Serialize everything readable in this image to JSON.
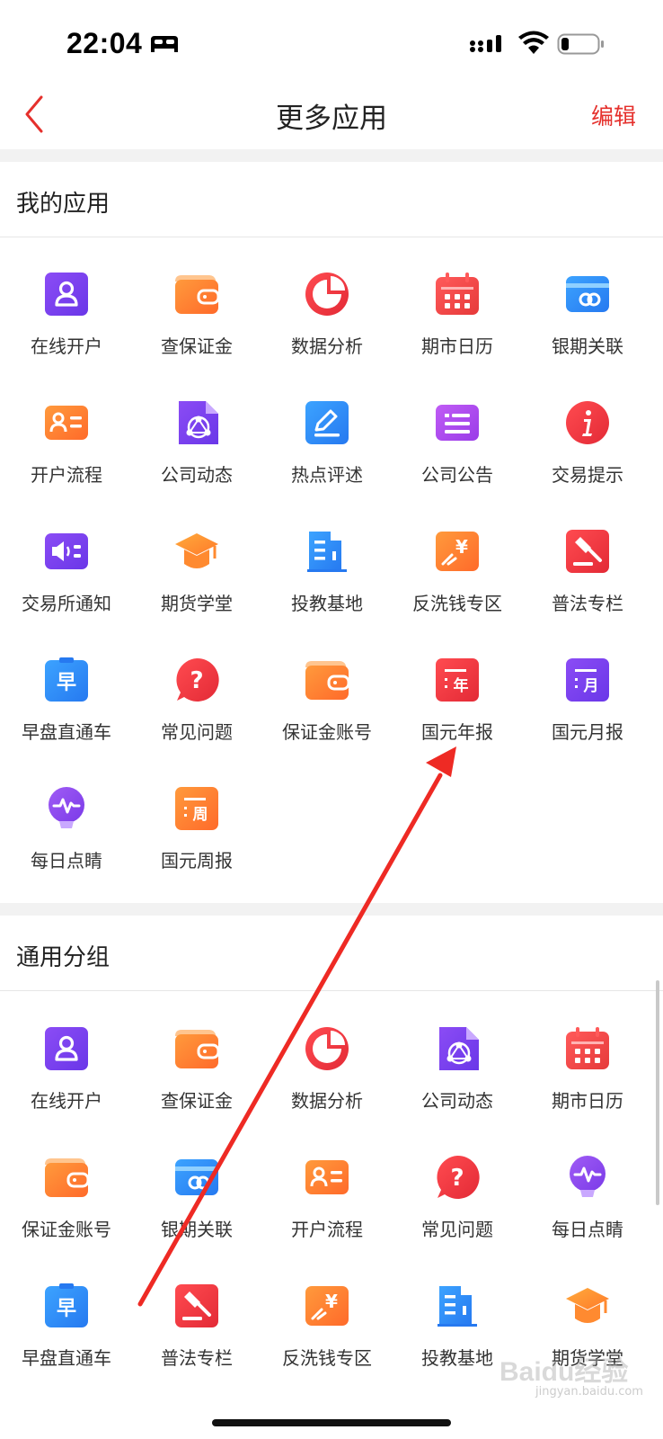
{
  "status_bar": {
    "time": "22:04"
  },
  "nav": {
    "title": "更多应用",
    "edit_label": "编辑"
  },
  "sections": [
    {
      "title": "我的应用",
      "items": [
        {
          "label": "在线开户",
          "icon": "user-card-icon"
        },
        {
          "label": "查保证金",
          "icon": "wallet-icon"
        },
        {
          "label": "数据分析",
          "icon": "pie-chart-icon"
        },
        {
          "label": "期市日历",
          "icon": "calendar-icon"
        },
        {
          "label": "银期关联",
          "icon": "bank-link-icon"
        },
        {
          "label": "开户流程",
          "icon": "id-card-icon"
        },
        {
          "label": "公司动态",
          "icon": "share-doc-icon"
        },
        {
          "label": "热点评述",
          "icon": "edit-icon"
        },
        {
          "label": "公司公告",
          "icon": "notice-icon"
        },
        {
          "label": "交易提示",
          "icon": "info-icon"
        },
        {
          "label": "交易所通知",
          "icon": "speaker-icon"
        },
        {
          "label": "期货学堂",
          "icon": "graduation-cap-icon"
        },
        {
          "label": "投教基地",
          "icon": "building-icon"
        },
        {
          "label": "反洗钱专区",
          "icon": "anti-money-laundering-icon"
        },
        {
          "label": "普法专栏",
          "icon": "gavel-icon"
        },
        {
          "label": "早盘直通车",
          "icon": "morning-report-icon",
          "glyph": "早"
        },
        {
          "label": "常见问题",
          "icon": "question-icon"
        },
        {
          "label": "保证金账号",
          "icon": "wallet-icon"
        },
        {
          "label": "国元年报",
          "icon": "annual-report-icon",
          "glyph": "年"
        },
        {
          "label": "国元月报",
          "icon": "monthly-report-icon",
          "glyph": "月"
        },
        {
          "label": "每日点睛",
          "icon": "pulse-bulb-icon"
        },
        {
          "label": "国元周报",
          "icon": "weekly-report-icon",
          "glyph": "周"
        }
      ]
    },
    {
      "title": "通用分组",
      "items": [
        {
          "label": "在线开户",
          "icon": "user-card-icon"
        },
        {
          "label": "查保证金",
          "icon": "wallet-icon"
        },
        {
          "label": "数据分析",
          "icon": "pie-chart-icon"
        },
        {
          "label": "公司动态",
          "icon": "share-doc-icon"
        },
        {
          "label": "期市日历",
          "icon": "calendar-icon"
        },
        {
          "label": "保证金账号",
          "icon": "wallet-icon"
        },
        {
          "label": "银期关联",
          "icon": "bank-link-icon"
        },
        {
          "label": "开户流程",
          "icon": "id-card-icon"
        },
        {
          "label": "常见问题",
          "icon": "question-icon"
        },
        {
          "label": "每日点睛",
          "icon": "pulse-bulb-icon"
        },
        {
          "label": "早盘直通车",
          "icon": "morning-report-icon",
          "glyph": "早"
        },
        {
          "label": "普法专栏",
          "icon": "gavel-icon"
        },
        {
          "label": "反洗钱专区",
          "icon": "anti-money-laundering-icon"
        },
        {
          "label": "投教基地",
          "icon": "building-icon"
        },
        {
          "label": "期货学堂",
          "icon": "graduation-cap-icon"
        }
      ]
    }
  ],
  "watermark": {
    "text": "Baidu经验",
    "sub": "jingyan.baidu.com"
  },
  "colors": {
    "accent": "#e5302c",
    "purple": "#7b3ff2",
    "orange": "#ff7a2f",
    "red": "#ef3b3b",
    "blue": "#2e8cf0",
    "arrow": "#ee2a24"
  }
}
